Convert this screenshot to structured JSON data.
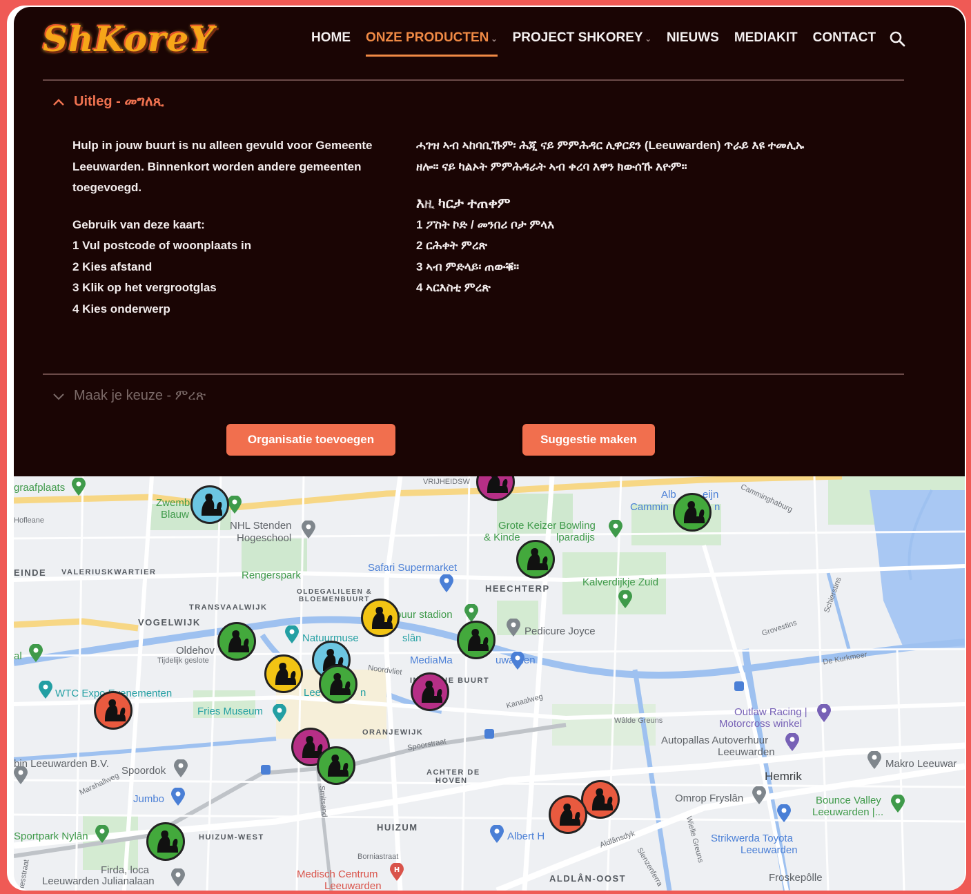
{
  "brand": {
    "logo_text": "ShKoreY"
  },
  "nav": {
    "items": [
      {
        "label": "HOME"
      },
      {
        "label": "ONZE PRODUCTEN",
        "active": true,
        "has_dropdown": true
      },
      {
        "label": "PROJECT SHKOREY",
        "has_dropdown": true
      },
      {
        "label": "NIEUWS"
      },
      {
        "label": "MEDIAKIT"
      },
      {
        "label": "CONTACT"
      }
    ],
    "search_icon": "search-icon"
  },
  "accordion": {
    "uitleg_title": "Uitleg - መግለጺ",
    "keuze_title": "Maak je keuze - ምረጽ"
  },
  "intro": {
    "nl_paragraph": "Hulp in jouw buurt is nu alleen gevuld voor Gemeente Leeuwarden. Binnenkort worden andere gemeenten toegevoegd.",
    "ti_paragraph": "ሓገዝ ኣብ ኣከባቢኹም፡ ሕጂ ናይ ምምሕዳር ሊዋርደን (Leeuwarden) ጥራይ እዩ ተመሊኡ ዘሎ። ናይ ካልኦት ምምሕዳራት ኣብ ቀረባ እዋን ክውሰኹ እዮም።"
  },
  "usage": {
    "nl_heading": "Gebruik van deze kaart:",
    "nl_steps": [
      "1 Vul postcode of woonplaats in",
      "2 Kies afstand",
      "3 Klik op het vergrootglas",
      "4 Kies onderwerp"
    ],
    "ti_heading": "እዚ ካርታ ተጠቀም",
    "ti_steps": [
      "1 ፖስት ኮድ / መንበሪ ቦታ ምላእ",
      "2 ርሕቀት ምረጽ",
      "3 ኣብ ምድላይ፡ ጠውቑ።",
      "4 ኣርእስቲ ምረጽ"
    ]
  },
  "buttons": {
    "add_org": "Organisatie toevoegen",
    "suggest": "Suggestie maken"
  },
  "map": {
    "labels": {
      "graafplaats": "graafplaats",
      "zwemb": "Zwemb",
      "blauw": "Blauw",
      "hofleane": "Hofleane",
      "nhl1": "NHL Stenden",
      "nhl2": "Hogeschool",
      "vrijheid": "VRIJHEIDSW",
      "alb": "Alb",
      "eijn": "eijn",
      "cammin": "Cammin",
      "n1": "n",
      "camminghaburg": "Camminghaburg",
      "keizer1": "Grote Keizer Bowling",
      "keizer2a": "& Kinde",
      "keizer2b": "lparadijs",
      "einde": "EINDE",
      "valerius": "VALERIUSKWARTIER",
      "renger": "Rengerspark",
      "safari": "Safari Supermarket",
      "olde1": "OLDEGALILEEN &",
      "olde2": "BLOEMENBUURT",
      "heechterp": "HEECHTERP",
      "kalverdijkje": "Kalverdijkje Zuid",
      "transvaal": "TRANSVAALWIJK",
      "vogelwijk": "VOGELWIJK",
      "stadion": "buur stadion",
      "pedicure": "Pedicure Joyce",
      "grovestins": "Grovestins",
      "schierstins": "Schierstins",
      "aldlandsdyk": "Aldlânsdyk",
      "natuurmus": "Natuurmuse",
      "slan": "slân",
      "oldehov": "Oldehov",
      "gesloten": "Tijdelijk geslote",
      "mediama": "MediaMa",
      "uwarden": "uwarden",
      "noordvliet": "Noordvliet",
      "dekurkmeer": "De Kurkmeer",
      "al": "al",
      "wtc": "WTC Expo Evenementen",
      "indische": "INDISCHE BUURT",
      "kanaalweg": "Kanaalweg",
      "fries": "Fries Museum",
      "lee": "Lee",
      "n2": "n",
      "oranjewijk": "ORANJEWIJK",
      "spoorstraat": "Spoorstraat",
      "wijdegreuns": "Wâlde Greuns",
      "outlaw1": "Outlaw Racing |",
      "outlaw2": "Motorcross winkel",
      "autopallas1": "Autopallas Autoverhuur",
      "autopallas2": "Leeuwarden",
      "bin": "bin Leeuwarden B.V.",
      "spoordok": "Spoordok",
      "marshall": "Marshallweg",
      "achter1": "ACHTER DE",
      "achter2": "HOVEN",
      "makro": "Makro Leeuwar",
      "hemrik": "Hemrik",
      "jumbo": "Jumbo",
      "omrop": "Omrop Fryslân",
      "bounce1": "Bounce Valley",
      "bounce2": "Leeuwarden |...",
      "sportpark": "Sportpark Nylân",
      "huizum": "HUIZUM",
      "huizumwest": "HUIZUM-WEST",
      "albert": "Albert H",
      "strikwerda1": "Strikwerda Toyota",
      "strikwerda2": "Leeuwarden",
      "borniastraat": "Borniastraat",
      "firda": "Firda, loca",
      "julianalaan": "Leeuwarden Julianalaan",
      "medisch1": "Medisch Centrum",
      "medisch2": "Leeuwarden",
      "aldlan": "ALDLÂN-OOST",
      "froskepolle": "Froskepôlle",
      "tesstraat": "tesstraat",
      "smitsand": "Smitsand",
      "wielegreuns": "Wielle Greuns",
      "slenzenferra": "Slenzenferra"
    },
    "markers": [
      {
        "color": "#6cc6e2"
      },
      {
        "color": "#b62f86"
      },
      {
        "color": "#43a93c"
      },
      {
        "color": "#43a93c"
      },
      {
        "color": "#f2c414"
      },
      {
        "color": "#43a93c"
      },
      {
        "color": "#43a93c"
      },
      {
        "color": "#6cc6e2"
      },
      {
        "color": "#f2c414"
      },
      {
        "color": "#43a93c"
      },
      {
        "color": "#b62f86"
      },
      {
        "color": "#e95a3f"
      },
      {
        "color": "#b62f86"
      },
      {
        "color": "#43a93c"
      },
      {
        "color": "#e95a3f"
      },
      {
        "color": "#e95a3f"
      },
      {
        "color": "#43a93c"
      }
    ]
  }
}
